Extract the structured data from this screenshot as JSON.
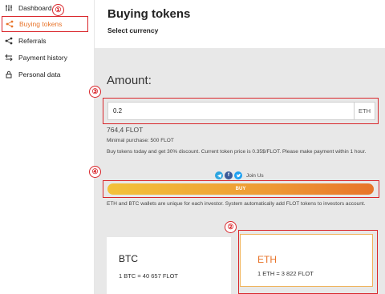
{
  "sidebar": {
    "items": [
      {
        "label": "Dashboard",
        "icon": "sliders-icon"
      },
      {
        "label": "Buying tokens",
        "icon": "share-icon"
      },
      {
        "label": "Referrals",
        "icon": "share-icon"
      },
      {
        "label": "Payment history",
        "icon": "exchange-icon"
      },
      {
        "label": "Personal data",
        "icon": "lock-icon"
      }
    ]
  },
  "header": {
    "title": "Buying tokens",
    "subtitle": "Select currency"
  },
  "purchase": {
    "amount_label": "Amount:",
    "amount_value": "0.2",
    "amount_unit": "ETH",
    "flot_value": "764,4 FLOT",
    "min_purchase": "Minimal purchase: 500 FLOT",
    "discount_text": "Buy tokens today and get 30% discount. Current token price is 0.35$/FLOT. Please make payment within 1 hour.",
    "join_us": "Join Us",
    "buy_label": "BUY",
    "wallet_text": "ETH and BTC wallets are unique for each investor. System automatically add FLOT tokens to investors account."
  },
  "currencies": [
    {
      "name": "BTC",
      "rate": "1 BTC = 40 657 FLOT"
    },
    {
      "name": "ETH",
      "rate": "1 ETH = 3 822 FLOT"
    }
  ],
  "markers": [
    "①",
    "②",
    "③",
    "④"
  ],
  "colors": {
    "accent": "#e8742a",
    "highlight": "#d9262b",
    "main_bg": "#e8e8e8"
  }
}
